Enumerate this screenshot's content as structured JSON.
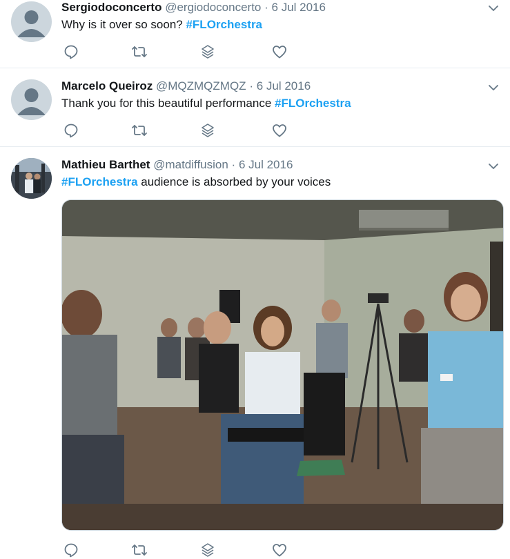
{
  "tweets": [
    {
      "name": "Sergiodoconcerto",
      "handle": "@ergiodoconcerto",
      "separator": "·",
      "date": "6 Jul 2016",
      "text": "Why is it over so soon? ",
      "hashtag": "#FLOrchestra",
      "text_after": ""
    },
    {
      "name": "Marcelo Queiroz",
      "handle": "@MQZMQZMQZ",
      "separator": "·",
      "date": "6 Jul 2016",
      "text": "Thank you for this beautiful performance ",
      "hashtag": "#FLOrchestra",
      "text_after": ""
    },
    {
      "name": "Mathieu Barthet",
      "handle": "@matdiffusion",
      "separator": "·",
      "date": "6 Jul 2016",
      "text": "",
      "hashtag": "#FLOrchestra",
      "text_after": " audience is absorbed by your voices"
    }
  ],
  "icons": [
    "reply-icon",
    "retweet-icon",
    "stack-icon",
    "like-icon",
    "chevron-down-icon"
  ],
  "colors": {
    "accent": "#1da1f2",
    "muted": "#657786",
    "text": "#14171a",
    "divider": "#e6ecf0"
  }
}
